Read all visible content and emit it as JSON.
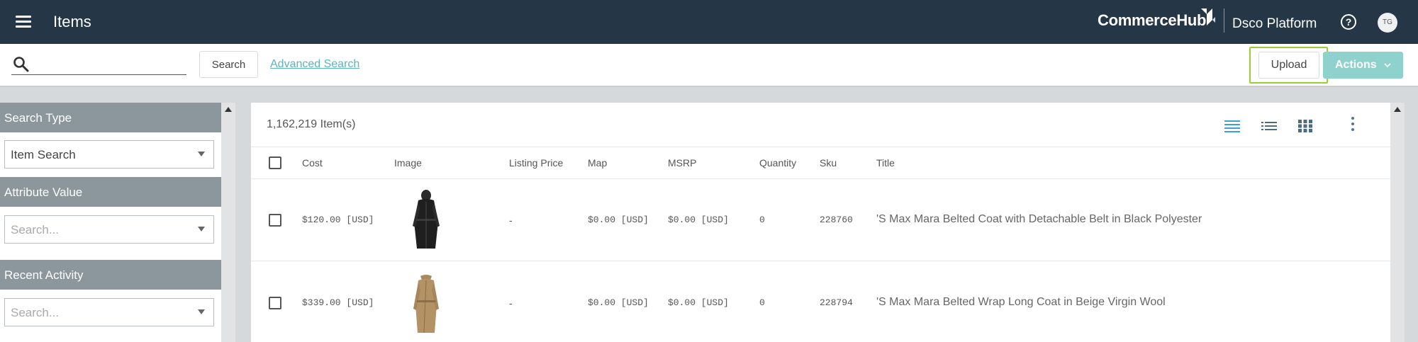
{
  "header": {
    "page_title": "Items",
    "brand": "CommerceHub",
    "platform": "Dsco Platform",
    "help_symbol": "?",
    "avatar_initials": "TG"
  },
  "toolbar": {
    "search_placeholder": "",
    "search_button": "Search",
    "advanced_search": "Advanced Search",
    "upload_button": "Upload",
    "actions_button": "Actions"
  },
  "sidebar": {
    "search_type_header": "Search Type",
    "search_type_value": "Item Search",
    "attribute_value_header": "Attribute Value",
    "attribute_value_placeholder": "Search...",
    "recent_activity_header": "Recent Activity",
    "recent_activity_placeholder": "Search..."
  },
  "main": {
    "item_count": "1,162,219 Item(s)",
    "columns": [
      "Cost",
      "Image",
      "Listing Price",
      "Map",
      "MSRP",
      "Quantity",
      "Sku",
      "Title"
    ],
    "rows": [
      {
        "cost": "$120.00 [USD]",
        "image": "black-coat-image",
        "listing_price": "-",
        "map": "$0.00 [USD]",
        "msrp": "$0.00 [USD]",
        "quantity": "0",
        "sku": "228760",
        "title": "'S Max Mara Belted Coat with Detachable Belt in Black Polyester"
      },
      {
        "cost": "$339.00 [USD]",
        "image": "beige-coat-image",
        "listing_price": "-",
        "map": "$0.00 [USD]",
        "msrp": "$0.00 [USD]",
        "quantity": "0",
        "sku": "228794",
        "title": "'S Max Mara Belted Wrap Long Coat in Beige Virgin Wool"
      }
    ]
  },
  "colors": {
    "topbar": "#253646",
    "accent_link": "#5eb3bd",
    "actions_bg": "#8fd1cc",
    "highlight_outline": "#9acd3a",
    "sidebar_header": "#8b979d",
    "view_icon_active": "#3aa3d6",
    "view_icon": "#4b6b80"
  }
}
